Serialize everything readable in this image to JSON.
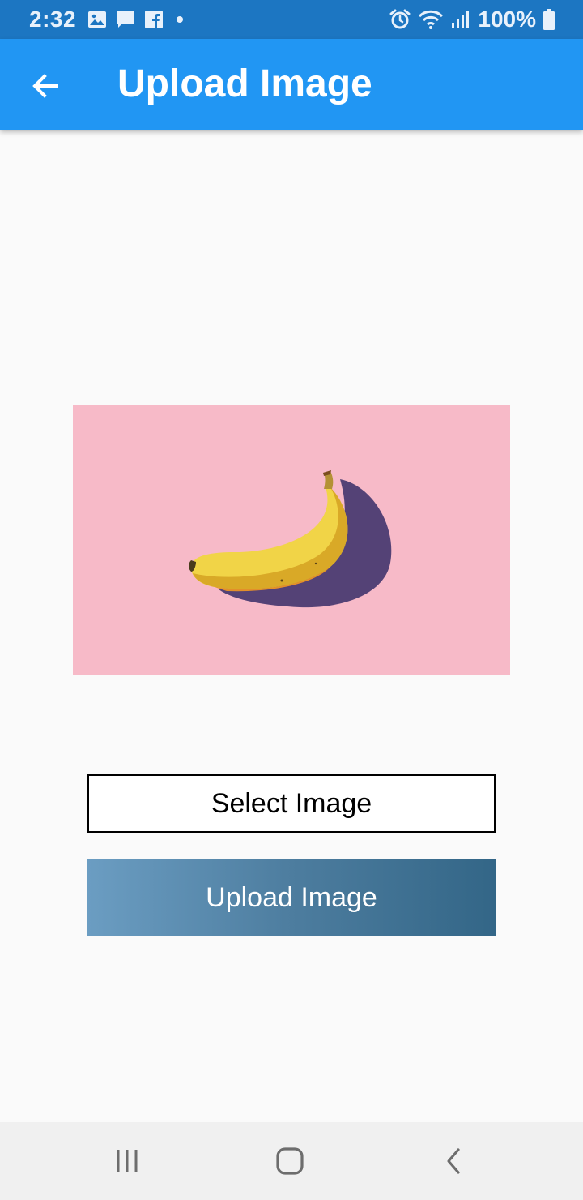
{
  "status_bar": {
    "time": "2:32",
    "battery_text": "100%",
    "left_icons": [
      "gallery-icon",
      "message-icon",
      "facebook-icon",
      "dot-icon"
    ],
    "right_icons": [
      "alarm-icon",
      "wifi-icon",
      "signal-icon",
      "battery-icon"
    ]
  },
  "app_bar": {
    "title": "Upload Image",
    "back_icon": "arrow-back-icon",
    "color": "#2196f3"
  },
  "preview": {
    "description_icon": "banana-image",
    "background_color": "#f7bac8"
  },
  "buttons": {
    "select_label": "Select Image",
    "upload_label": "Upload Image"
  },
  "nav_bar": {
    "icons": [
      "recents-icon",
      "home-icon",
      "back-icon"
    ]
  }
}
